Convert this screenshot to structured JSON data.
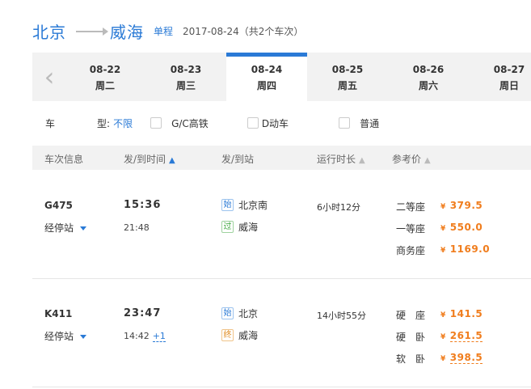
{
  "header": {
    "from": "北京",
    "to": "威海",
    "trip_type": "单程",
    "date_info": "2017-08-24（共2个车次）"
  },
  "dates": [
    {
      "date": "08-22",
      "weekday": "周二"
    },
    {
      "date": "08-23",
      "weekday": "周三"
    },
    {
      "date": "08-24",
      "weekday": "周四"
    },
    {
      "date": "08-25",
      "weekday": "周五"
    },
    {
      "date": "08-26",
      "weekday": "周六"
    },
    {
      "date": "08-27",
      "weekday": "周日"
    }
  ],
  "active_date_index": 2,
  "filter": {
    "label1": "车",
    "label2": "型:",
    "unlimited": "不限",
    "options": [
      "G/C高铁",
      "D动车",
      "普通"
    ]
  },
  "table_header": {
    "train_info": "车次信息",
    "time": "发/到时间",
    "station": "发/到站",
    "duration": "运行时长",
    "price": "参考价"
  },
  "trains": [
    {
      "number": "G475",
      "stops_label": "经停站",
      "depart": "15:36",
      "arrive": "21:48",
      "arrive_plus": "",
      "from_tag": "始",
      "from_station": "北京南",
      "to_tag": "过",
      "to_station": "威海",
      "duration": "6小时12分",
      "seats": [
        {
          "name": "二等座",
          "price": "379.5"
        },
        {
          "name": "一等座",
          "price": "550.0"
        },
        {
          "name": "商务座",
          "price": "1169.0"
        }
      ]
    },
    {
      "number": "K411",
      "stops_label": "经停站",
      "depart": "23:47",
      "arrive": "14:42",
      "arrive_plus": "+1",
      "from_tag": "始",
      "from_station": "北京",
      "to_tag": "终",
      "to_station": "威海",
      "duration": "14小时55分",
      "seats": [
        {
          "name": "硬　座",
          "price": "141.5"
        },
        {
          "name": "硬　卧",
          "price": "261.5"
        },
        {
          "name": "软　卧",
          "price": "398.5"
        }
      ]
    }
  ],
  "currency": "¥",
  "accent_color": "#2a7ad6",
  "price_color": "#f07d1d"
}
